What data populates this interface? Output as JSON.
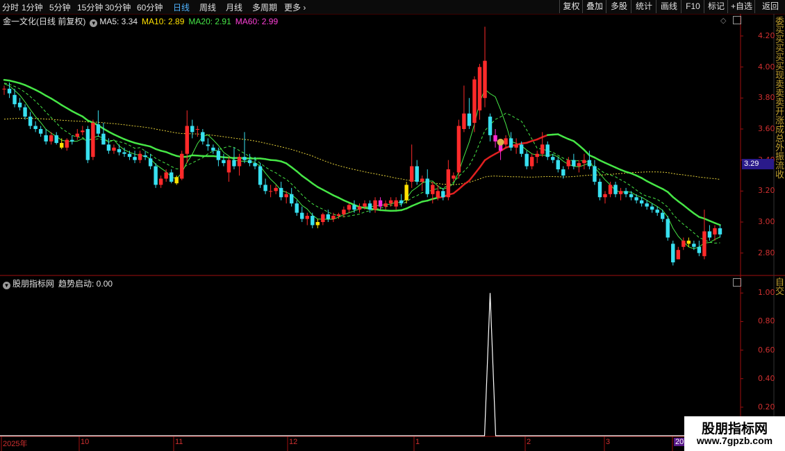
{
  "toolbar": {
    "timeframes": [
      "分时",
      "1分钟",
      "5分钟",
      "15分钟",
      "30分钟",
      "60分钟",
      "日线",
      "周线",
      "月线",
      "多周期",
      "更多"
    ],
    "active": "日线",
    "right_buttons": [
      "复权",
      "叠加",
      "多股",
      "统计",
      "画线",
      "F10",
      "标记",
      "+自选",
      "返回"
    ]
  },
  "main_legend": {
    "stock": "金一文化(日线 前复权)",
    "ma5": "MA5: 3.34",
    "ma10": "MA10: 2.89",
    "ma20": "MA20: 2.91",
    "ma60": "MA60: 2.99"
  },
  "sub_legend": {
    "indicator": "股朋指标网",
    "trend": "趋势启动: 0.00"
  },
  "colors": {
    "up": "#ff2a2a",
    "down": "#38e0f0",
    "yellow": "#ffe100",
    "magenta": "#ff2ad4",
    "ma_green": "#46e646",
    "ma_red": "#e02020",
    "ma60": "#e6d23a",
    "axis": "#a01010"
  },
  "y_axis_main": [
    "4.20",
    "4.00",
    "3.80",
    "3.60",
    "3.40",
    "3.20",
    "3.00",
    "2.80"
  ],
  "y_axis_sub": [
    "1.00",
    "0.80",
    "0.60",
    "0.40",
    "0.20"
  ],
  "x_axis": [
    "2025年",
    "10",
    "11",
    "12",
    "1",
    "2",
    "3",
    "20"
  ],
  "last_price": "3.29",
  "right_strip_top": "委买买买买买现卖卖卖开涨成总外振流收",
  "right_strip_sub": "自交",
  "watermark": {
    "line1": "股朋指标网",
    "line2": "www.7gpzb.com"
  },
  "chart_data": {
    "type": "candlestick",
    "ylim": [
      2.66,
      4.28
    ],
    "sub_ylim": [
      0,
      1.05
    ],
    "candles": [
      [
        3.86,
        3.88,
        3.82,
        3.86
      ],
      [
        3.86,
        3.9,
        3.8,
        3.83
      ],
      [
        3.82,
        3.86,
        3.74,
        3.76
      ],
      [
        3.77,
        3.8,
        3.72,
        3.74
      ],
      [
        3.74,
        3.76,
        3.66,
        3.68
      ],
      [
        3.68,
        3.71,
        3.6,
        3.62
      ],
      [
        3.62,
        3.65,
        3.58,
        3.6
      ],
      [
        3.6,
        3.62,
        3.55,
        3.57
      ],
      [
        3.56,
        3.6,
        3.5,
        3.52
      ],
      [
        3.52,
        3.58,
        3.5,
        3.56
      ],
      [
        3.56,
        3.58,
        3.5,
        3.51
      ],
      [
        3.51,
        3.54,
        3.47,
        3.48
      ],
      [
        3.48,
        3.54,
        3.46,
        3.53
      ],
      [
        3.53,
        3.56,
        3.5,
        3.52
      ],
      [
        3.55,
        3.6,
        3.53,
        3.57
      ],
      [
        3.58,
        3.62,
        3.56,
        3.59
      ],
      [
        3.6,
        3.62,
        3.38,
        3.4
      ],
      [
        3.42,
        3.66,
        3.4,
        3.64
      ],
      [
        3.63,
        3.72,
        3.55,
        3.57
      ],
      [
        3.57,
        3.64,
        3.5,
        3.5
      ],
      [
        3.5,
        3.54,
        3.44,
        3.46
      ],
      [
        3.46,
        3.5,
        3.44,
        3.48
      ],
      [
        3.47,
        3.5,
        3.43,
        3.45
      ],
      [
        3.45,
        3.48,
        3.42,
        3.44
      ],
      [
        3.44,
        3.46,
        3.4,
        3.42
      ],
      [
        3.42,
        3.46,
        3.38,
        3.4
      ],
      [
        3.4,
        3.46,
        3.38,
        3.44
      ],
      [
        3.43,
        3.46,
        3.4,
        3.42
      ],
      [
        3.41,
        3.44,
        3.34,
        3.36
      ],
      [
        3.36,
        3.38,
        3.22,
        3.24
      ],
      [
        3.24,
        3.3,
        3.22,
        3.28
      ],
      [
        3.28,
        3.34,
        3.26,
        3.32
      ],
      [
        3.32,
        3.34,
        3.25,
        3.26
      ],
      [
        3.25,
        3.3,
        3.24,
        3.29
      ],
      [
        3.28,
        3.46,
        3.27,
        3.44
      ],
      [
        3.44,
        3.72,
        3.38,
        3.62
      ],
      [
        3.62,
        3.66,
        3.54,
        3.58
      ],
      [
        3.6,
        3.62,
        3.55,
        3.6
      ],
      [
        3.58,
        3.6,
        3.5,
        3.52
      ],
      [
        3.5,
        3.54,
        3.46,
        3.49
      ],
      [
        3.48,
        3.5,
        3.44,
        3.46
      ],
      [
        3.46,
        3.48,
        3.36,
        3.4
      ],
      [
        3.4,
        3.44,
        3.36,
        3.38
      ],
      [
        3.32,
        3.42,
        3.26,
        3.4
      ],
      [
        3.4,
        3.48,
        3.34,
        3.36
      ],
      [
        3.36,
        3.44,
        3.3,
        3.42
      ],
      [
        3.42,
        3.58,
        3.38,
        3.4
      ],
      [
        3.4,
        3.44,
        3.36,
        3.38
      ],
      [
        3.38,
        3.42,
        3.34,
        3.36
      ],
      [
        3.36,
        3.38,
        3.22,
        3.24
      ],
      [
        3.24,
        3.28,
        3.18,
        3.2
      ],
      [
        3.2,
        3.24,
        3.16,
        3.2
      ],
      [
        3.2,
        3.24,
        3.18,
        3.22
      ],
      [
        3.22,
        3.26,
        3.14,
        3.16
      ],
      [
        3.16,
        3.2,
        3.12,
        3.18
      ],
      [
        3.18,
        3.22,
        3.1,
        3.12
      ],
      [
        3.12,
        3.14,
        3.04,
        3.06
      ],
      [
        3.06,
        3.1,
        3.0,
        3.02
      ],
      [
        3.02,
        3.06,
        2.98,
        3.04
      ],
      [
        3.04,
        3.06,
        2.96,
        2.98
      ],
      [
        2.98,
        3.02,
        2.96,
        3.0
      ],
      [
        3.0,
        3.06,
        2.98,
        3.05
      ],
      [
        3.05,
        3.08,
        3.0,
        3.02
      ],
      [
        3.02,
        3.06,
        3.0,
        3.04
      ],
      [
        3.04,
        3.06,
        3.02,
        3.05
      ],
      [
        3.05,
        3.1,
        3.03,
        3.08
      ],
      [
        3.08,
        3.12,
        3.06,
        3.11
      ],
      [
        3.11,
        3.14,
        3.06,
        3.08
      ],
      [
        3.08,
        3.12,
        3.06,
        3.1
      ],
      [
        3.1,
        3.14,
        3.08,
        3.12
      ],
      [
        3.12,
        3.14,
        3.06,
        3.08
      ],
      [
        3.08,
        3.16,
        3.06,
        3.14
      ],
      [
        3.14,
        3.16,
        3.08,
        3.1
      ],
      [
        3.1,
        3.14,
        3.08,
        3.12
      ],
      [
        3.12,
        3.16,
        3.1,
        3.14
      ],
      [
        3.1,
        3.16,
        3.08,
        3.14
      ],
      [
        3.14,
        3.18,
        3.1,
        3.12
      ],
      [
        3.14,
        3.26,
        3.12,
        3.24
      ],
      [
        3.26,
        3.5,
        3.22,
        3.36
      ],
      [
        3.36,
        3.4,
        3.24,
        3.26
      ],
      [
        3.26,
        3.3,
        3.2,
        3.28
      ],
      [
        3.28,
        3.34,
        3.16,
        3.18
      ],
      [
        3.18,
        3.26,
        3.12,
        3.24
      ],
      [
        3.16,
        3.24,
        3.14,
        3.2
      ],
      [
        3.2,
        3.22,
        3.14,
        3.16
      ],
      [
        3.16,
        3.4,
        3.14,
        3.34
      ],
      [
        3.28,
        3.32,
        3.26,
        3.3
      ],
      [
        3.32,
        3.66,
        3.28,
        3.62
      ],
      [
        3.6,
        3.88,
        3.58,
        3.7
      ],
      [
        3.7,
        3.8,
        3.6,
        3.62
      ],
      [
        3.64,
        3.94,
        3.58,
        3.92
      ],
      [
        3.72,
        4.02,
        3.66,
        4.0
      ],
      [
        3.8,
        4.26,
        3.74,
        4.04
      ],
      [
        3.68,
        3.7,
        3.52,
        3.56
      ],
      [
        3.56,
        3.6,
        3.48,
        3.52
      ],
      [
        3.46,
        3.52,
        3.4,
        3.5
      ],
      [
        3.5,
        3.56,
        3.48,
        3.54
      ],
      [
        3.54,
        3.58,
        3.46,
        3.48
      ],
      [
        3.48,
        3.54,
        3.44,
        3.5
      ],
      [
        3.5,
        3.52,
        3.42,
        3.44
      ],
      [
        3.44,
        3.46,
        3.34,
        3.36
      ],
      [
        3.36,
        3.44,
        3.34,
        3.42
      ],
      [
        3.42,
        3.46,
        3.38,
        3.44
      ],
      [
        3.44,
        3.58,
        3.42,
        3.5
      ],
      [
        3.5,
        3.52,
        3.4,
        3.42
      ],
      [
        3.42,
        3.44,
        3.38,
        3.4
      ],
      [
        3.4,
        3.42,
        3.32,
        3.34
      ],
      [
        3.34,
        3.36,
        3.28,
        3.3
      ],
      [
        3.36,
        3.42,
        3.34,
        3.4
      ],
      [
        3.4,
        3.44,
        3.34,
        3.36
      ],
      [
        3.36,
        3.4,
        3.32,
        3.38
      ],
      [
        3.38,
        3.44,
        3.34,
        3.4
      ],
      [
        3.4,
        3.46,
        3.34,
        3.36
      ],
      [
        3.36,
        3.4,
        3.24,
        3.26
      ],
      [
        3.26,
        3.28,
        3.14,
        3.16
      ],
      [
        3.16,
        3.2,
        3.12,
        3.18
      ],
      [
        3.18,
        3.26,
        3.16,
        3.24
      ],
      [
        3.24,
        3.26,
        3.16,
        3.18
      ],
      [
        3.18,
        3.22,
        3.14,
        3.2
      ],
      [
        3.2,
        3.22,
        3.16,
        3.18
      ],
      [
        3.18,
        3.2,
        3.14,
        3.16
      ],
      [
        3.16,
        3.18,
        3.12,
        3.14
      ],
      [
        3.14,
        3.16,
        3.1,
        3.12
      ],
      [
        3.12,
        3.14,
        3.08,
        3.1
      ],
      [
        3.1,
        3.12,
        3.06,
        3.08
      ],
      [
        3.08,
        3.1,
        3.04,
        3.06
      ],
      [
        3.06,
        3.08,
        3.0,
        3.02
      ],
      [
        3.02,
        3.04,
        2.88,
        2.9
      ],
      [
        2.86,
        2.88,
        2.72,
        2.74
      ],
      [
        2.76,
        2.84,
        2.76,
        2.82
      ],
      [
        2.84,
        2.9,
        2.82,
        2.88
      ],
      [
        2.88,
        2.9,
        2.84,
        2.86
      ],
      [
        2.86,
        2.88,
        2.82,
        2.84
      ],
      [
        2.84,
        2.88,
        2.78,
        2.8
      ],
      [
        2.78,
        3.08,
        2.76,
        2.94
      ],
      [
        2.94,
        2.98,
        2.88,
        2.9
      ],
      [
        2.92,
        2.98,
        2.88,
        2.96
      ],
      [
        2.96,
        2.98,
        2.9,
        2.92
      ]
    ],
    "highlight_yellow": [
      11,
      33,
      60,
      77,
      131
    ],
    "highlight_magenta": [
      72,
      94,
      95
    ],
    "spike": {
      "index": 93,
      "value": 1.0
    }
  }
}
